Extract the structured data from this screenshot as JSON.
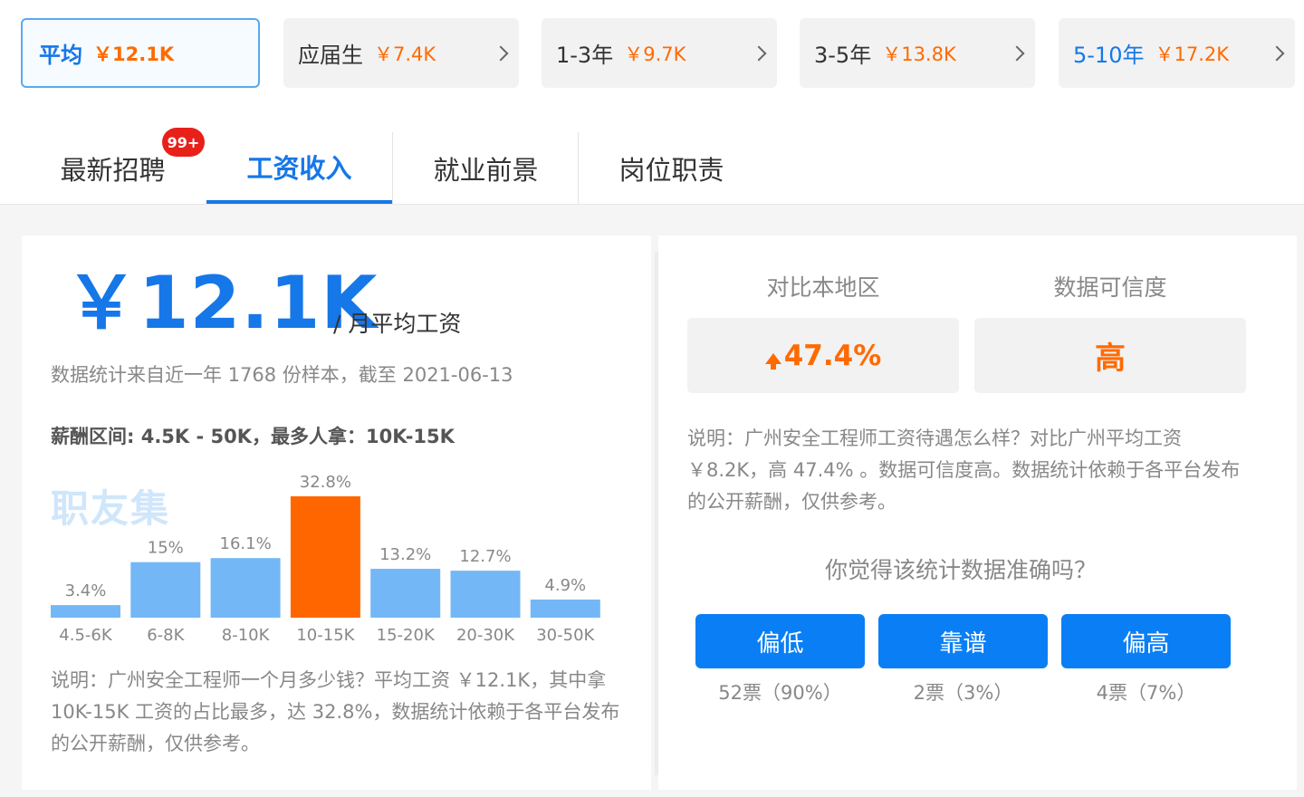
{
  "experience_tabs": [
    {
      "label": "平均",
      "value": "￥12.1K"
    },
    {
      "label": "应届生",
      "value": "￥7.4K"
    },
    {
      "label": "1-3年",
      "value": "￥9.7K"
    },
    {
      "label": "3-5年",
      "value": "￥13.8K"
    },
    {
      "label": "5-10年",
      "value": "￥17.2K"
    }
  ],
  "section_tabs": [
    {
      "label": "最新招聘",
      "badge": "99+"
    },
    {
      "label": "工资收入"
    },
    {
      "label": "就业前景"
    },
    {
      "label": "岗位职责"
    }
  ],
  "salary": {
    "main": "￥12.1K",
    "unit": "/ 月平均工资",
    "source": "数据统计来自近一年 1768 份样本，截至 2021-06-13",
    "range": "薪酬区间: 4.5K - 50K，最多人拿：10K-15K",
    "watermark": "职友集",
    "description": "说明：广州安全工程师一个月多少钱？平均工资 ￥12.1K，其中拿 10K-15K 工资的占比最多，达 32.8%，数据统计依赖于各平台发布的公开薪酬，仅供参考。"
  },
  "chart_data": {
    "type": "bar",
    "categories": [
      "4.5-6K",
      "6-8K",
      "8-10K",
      "10-15K",
      "15-20K",
      "20-30K",
      "30-50K"
    ],
    "values": [
      3.4,
      15,
      16.1,
      32.8,
      13.2,
      12.7,
      4.9
    ],
    "value_labels": [
      "3.4%",
      "15%",
      "16.1%",
      "32.8%",
      "13.2%",
      "12.7%",
      "4.9%"
    ],
    "highlight_index": 3,
    "colors": {
      "bar": "#74b7f7",
      "highlight": "#ff6600",
      "label": "#888888"
    },
    "title": "",
    "xlabel": "",
    "ylabel": ""
  },
  "compare": {
    "region_header": "对比本地区",
    "region_value": "47.4%",
    "trust_header": "数据可信度",
    "trust_value": "高",
    "description": "说明：广州安全工程师工资待遇怎么样？对比广州平均工资 ￥8.2K，高 47.4% 。数据可信度高。数据统计依赖于各平台发布的公开薪酬，仅供参考。"
  },
  "vote": {
    "question": "你觉得该统计数据准确吗？",
    "options": [
      {
        "label": "偏低",
        "count": "52票（90%）"
      },
      {
        "label": "靠谱",
        "count": "2票（3%）"
      },
      {
        "label": "偏高",
        "count": "4票（7%）"
      }
    ]
  },
  "icons": {
    "up_arrow": "up-arrow-icon",
    "chevron": "chevron-right-icon"
  },
  "colors": {
    "accent": "#1677e8",
    "salary_orange": "#ff6a00",
    "button_blue": "#0a7ff5",
    "badge_red": "#e8201a"
  }
}
